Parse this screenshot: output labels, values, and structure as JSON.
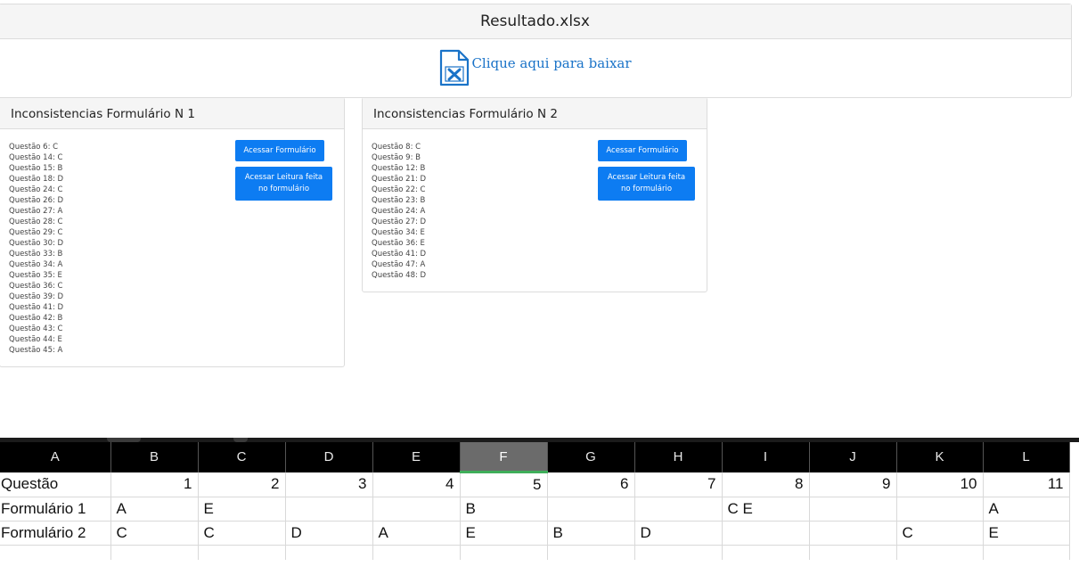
{
  "file": {
    "title": "Resultado.xlsx",
    "icon": "excel-file-icon",
    "download_label": "Clique aqui para baixar",
    "accent": "#1a73c8"
  },
  "forms": [
    {
      "title": "Inconsistencias Formulário N 1",
      "questions": [
        "Questão 6: C",
        "Questão 14: C",
        "Questão 15: B",
        "Questão 18: D",
        "Questão 24: C",
        "Questão 26: D",
        "Questão 27: A",
        "Questão 28: C",
        "Questão 29: C",
        "Questão 30: D",
        "Questão 33: B",
        "Questão 34: A",
        "Questão 35: E",
        "Questão 36: C",
        "Questão 39: D",
        "Questão 41: D",
        "Questão 42: B",
        "Questão 43: C",
        "Questão 44: E",
        "Questão 45: A"
      ],
      "button_form": "Acessar Formulário",
      "button_reading": "Acessar Leitura feita no formulário"
    },
    {
      "title": "Inconsistencias Formulário N 2",
      "questions": [
        "Questão 8: C",
        "Questão 9: B",
        "Questão 12: B",
        "Questão 21: D",
        "Questão 22: C",
        "Questão 23: B",
        "Questão 24: A",
        "Questão 27: D",
        "Questão 34: E",
        "Questão 36: E",
        "Questão 41: D",
        "Questão 47: A",
        "Questão 48: D"
      ],
      "button_form": "Acessar Formulário",
      "button_reading": "Acessar Leitura feita no formulário"
    }
  ],
  "spreadsheet": {
    "selected_column": "F",
    "columns": [
      "A",
      "B",
      "C",
      "D",
      "E",
      "F",
      "G",
      "H",
      "I",
      "J",
      "K",
      "L"
    ],
    "rows": [
      [
        "Questão",
        "1",
        "2",
        "3",
        "4",
        "5",
        "6",
        "7",
        "8",
        "9",
        "10",
        "11"
      ],
      [
        "Formulário 1",
        "A",
        "E",
        "",
        "",
        "B",
        "",
        "",
        "C E",
        "",
        "",
        "A"
      ],
      [
        "Formulário 2",
        "C",
        "C",
        "D",
        "A",
        "E",
        "B",
        "D",
        "",
        "",
        "C",
        "E"
      ]
    ],
    "colors": {
      "header_bg": "#000000",
      "selected_header_bg": "#6b6b6b",
      "selected_underline": "#3fae5a",
      "gridline": "#d9d9d9"
    }
  }
}
